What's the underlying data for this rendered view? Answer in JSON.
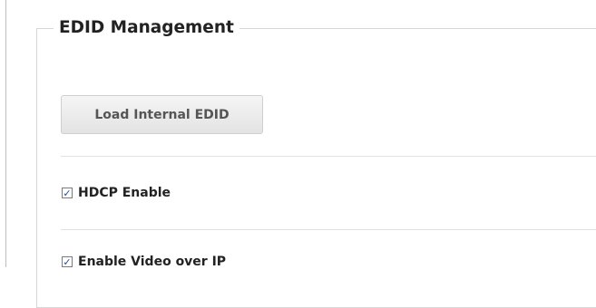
{
  "panel": {
    "title": "EDID Management"
  },
  "load_button": {
    "label": "Load Internal EDID"
  },
  "options": [
    {
      "label": "HDCP Enable",
      "checked": true
    },
    {
      "label": "Enable Video over IP",
      "checked": true
    }
  ],
  "icons": {
    "checkbox_checked": "checkmark-icon"
  },
  "colors": {
    "check_accent": "#1a4fa3",
    "text": "#222222",
    "button_text": "#555555"
  }
}
